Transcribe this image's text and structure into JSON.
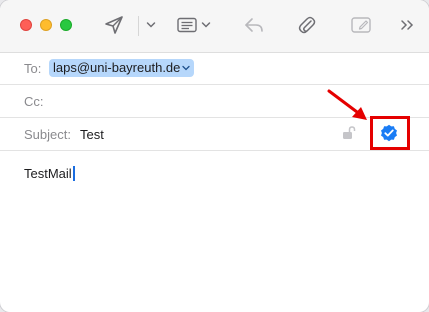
{
  "compose": {
    "to_label": "To:",
    "to_recipient": "laps@uni-bayreuth.de",
    "cc_label": "Cc:",
    "subject_label": "Subject:",
    "subject_value": "Test",
    "body_text": "TestMail"
  },
  "toolbar": {
    "icons": [
      "send-icon",
      "chevron-down-icon",
      "header-fields-icon",
      "chevron-down-icon",
      "reply-icon",
      "attachment-icon",
      "markup-icon",
      "more-chevron-icon"
    ]
  },
  "colors": {
    "highlight_box": "#e50000",
    "sign_badge": "#1a7cf5",
    "recipient_token": "#b6d7fb"
  }
}
